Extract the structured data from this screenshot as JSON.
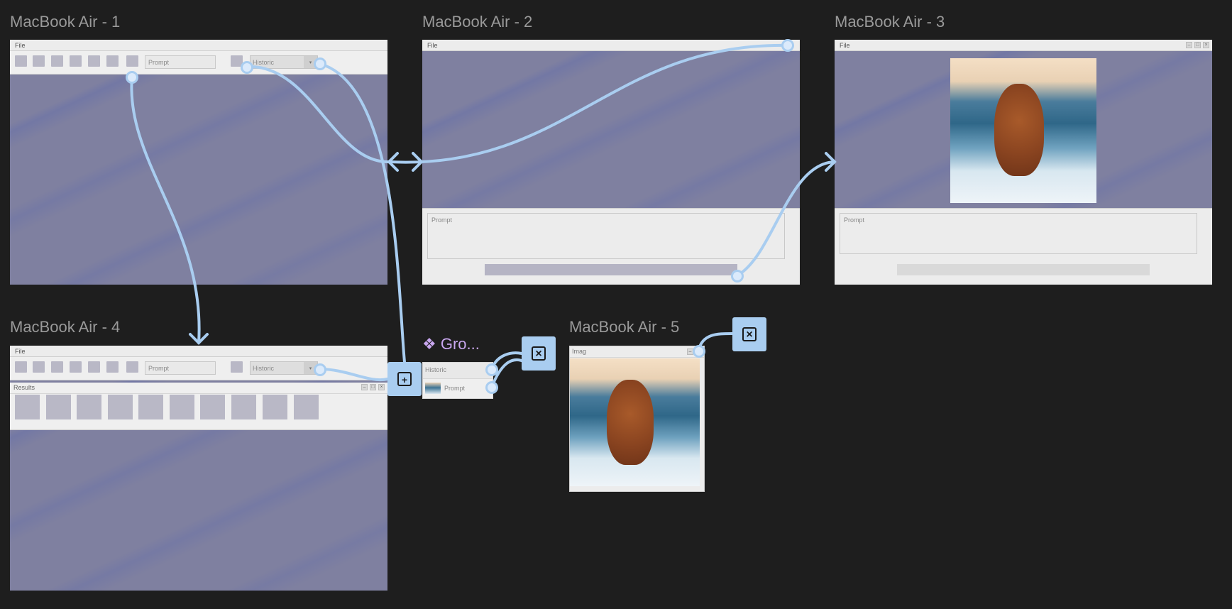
{
  "frames": [
    {
      "key": "f1",
      "title": "MacBook Air - 1"
    },
    {
      "key": "f2",
      "title": "MacBook Air - 2"
    },
    {
      "key": "f3",
      "title": "MacBook Air - 3"
    },
    {
      "key": "f4",
      "title": "MacBook Air - 4"
    },
    {
      "key": "f5",
      "title": "MacBook Air - 5"
    }
  ],
  "menu": {
    "file_label": "File"
  },
  "toolbar": {
    "prompt_placeholder": "Prompt",
    "historic_value": "Historic"
  },
  "prompt_area_label": "Prompt",
  "results_panel": {
    "title": "Results"
  },
  "image_window": {
    "title": "Imag"
  },
  "group": {
    "title": "Gro...",
    "rows": [
      {
        "label": "Historic"
      },
      {
        "label": "Prompt"
      }
    ]
  },
  "icons": {
    "group": "component-diamond-icon",
    "close": "close-square-icon",
    "add_frame": "add-frame-icon",
    "dog": "dog-photo"
  },
  "colors": {
    "canvas_bg": "#1e1e1e",
    "connector": "#a9cdf0",
    "frame_bg": "#7f80a0",
    "panel_bg": "#efefef",
    "group_title": "#c9a7f0"
  }
}
